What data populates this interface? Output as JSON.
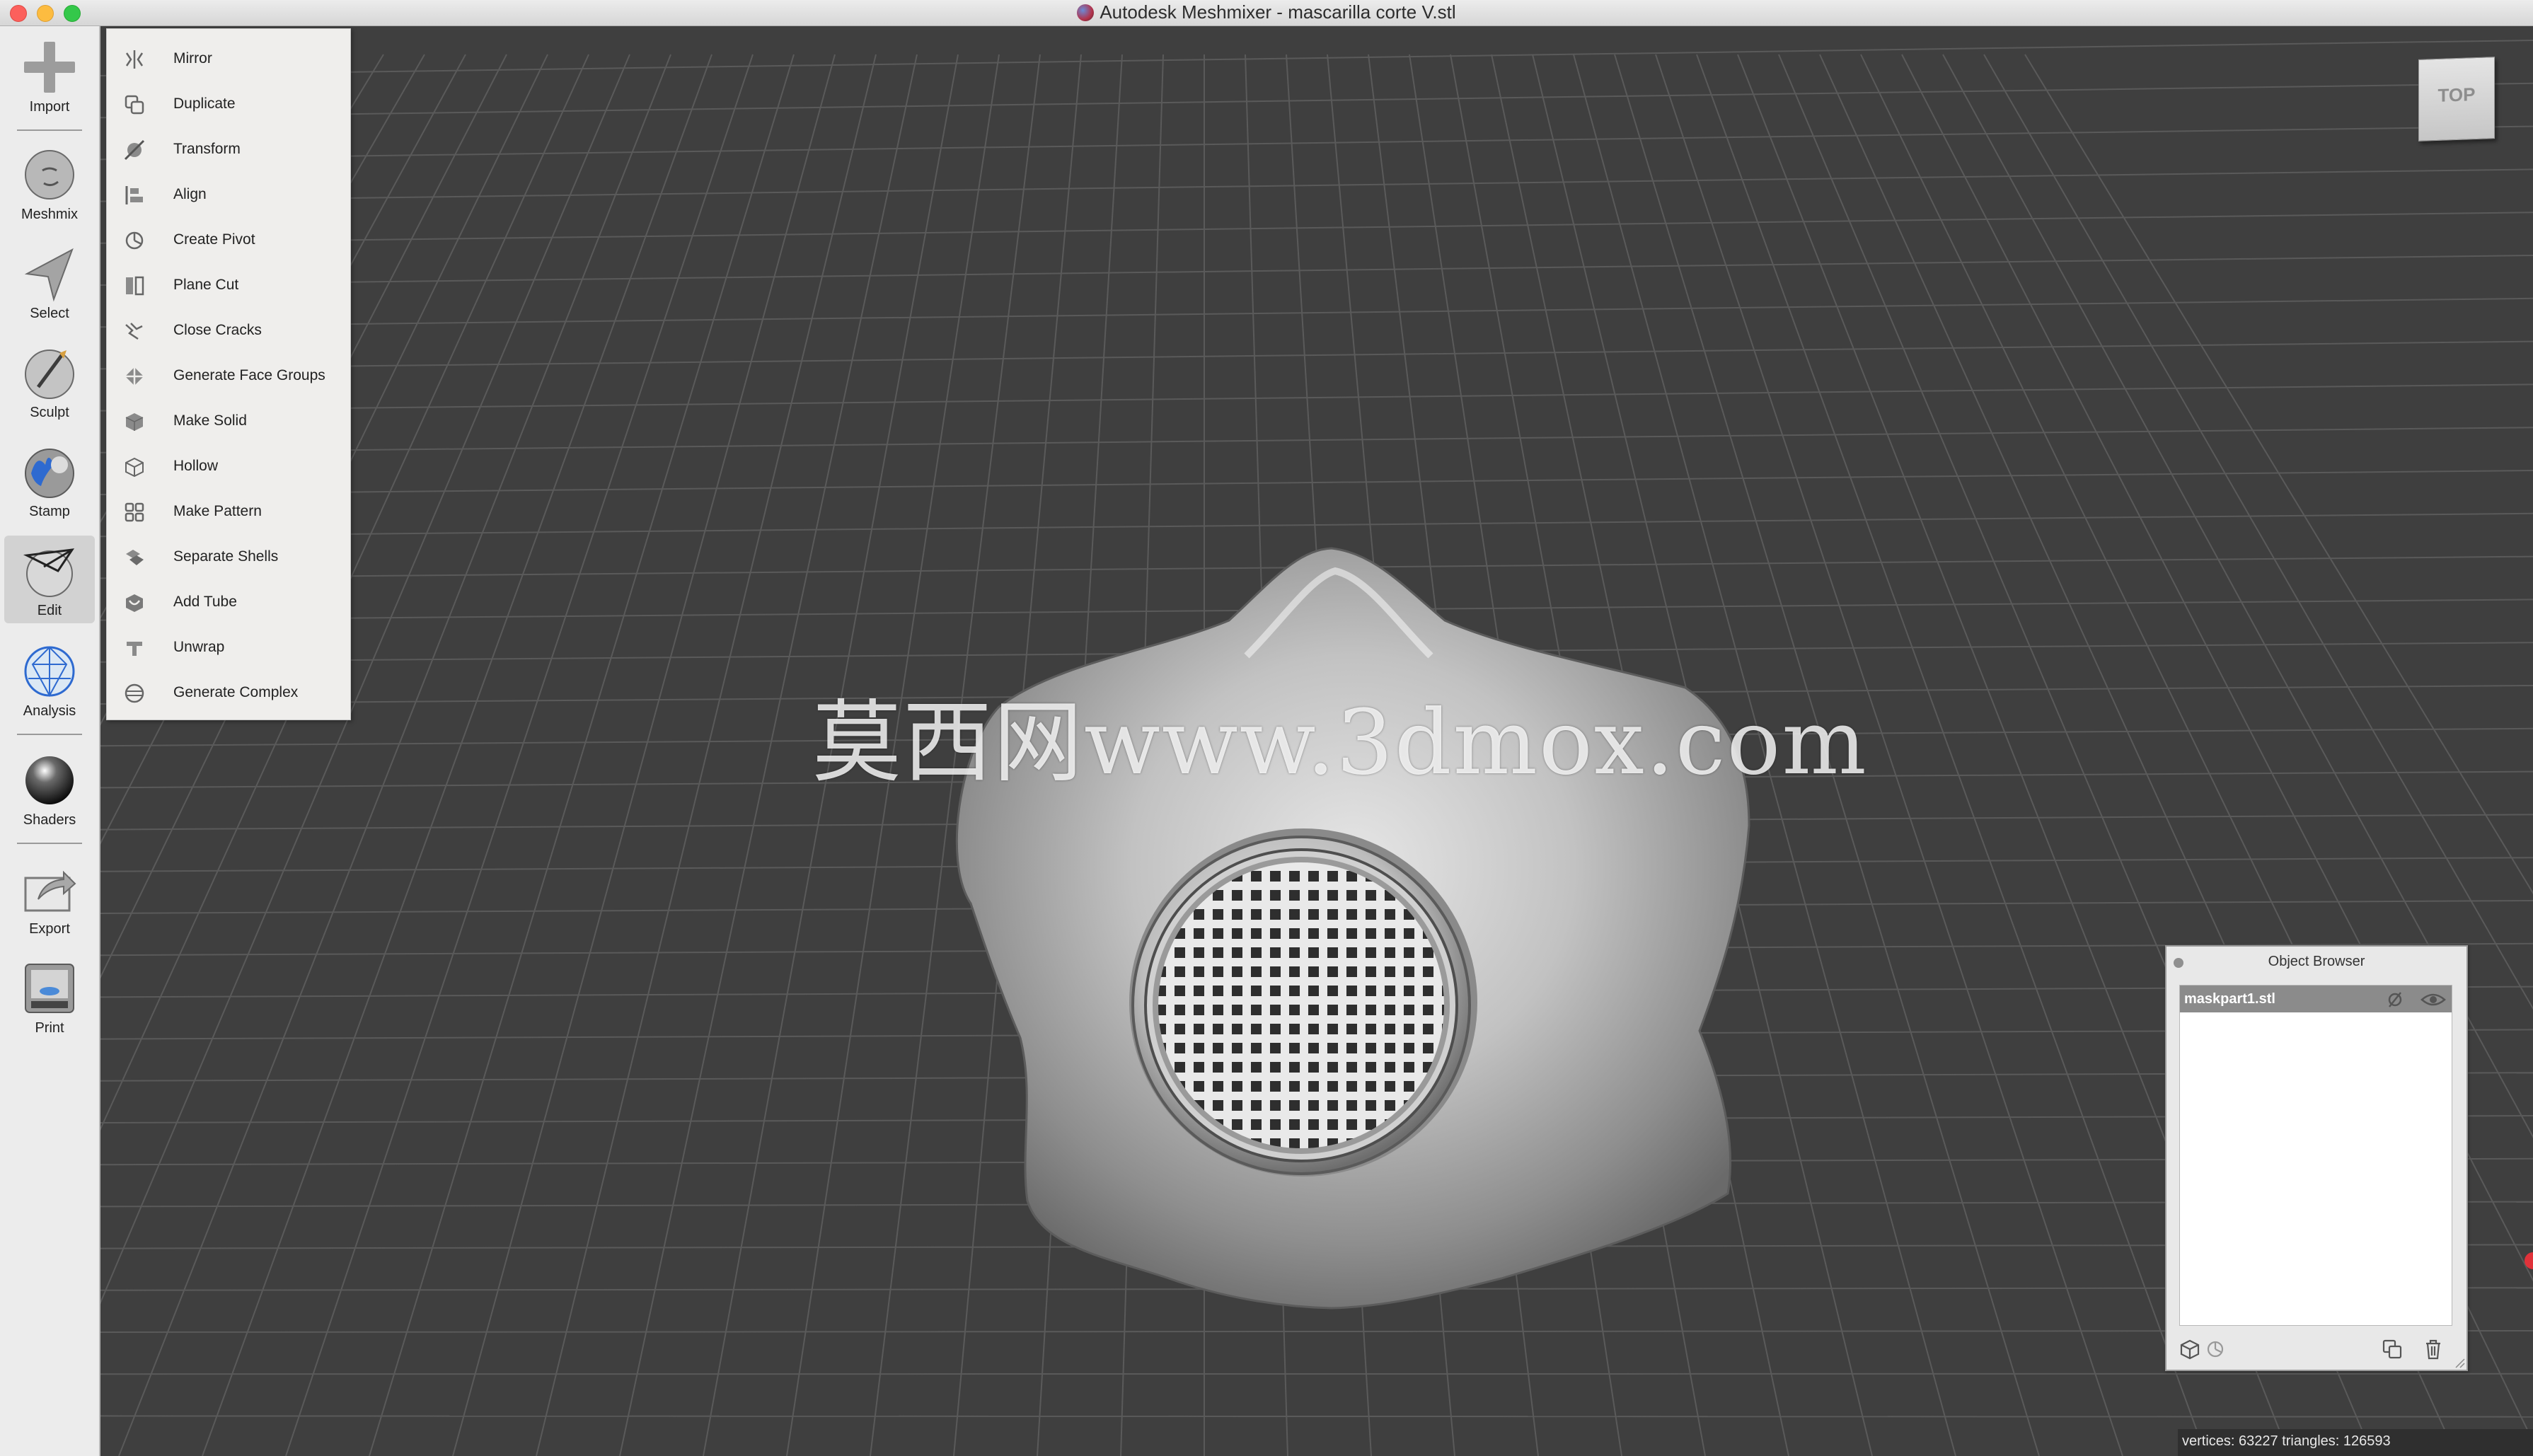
{
  "window": {
    "title": "Autodesk Meshmixer - mascarilla corte V.stl"
  },
  "toolbar": {
    "items": [
      {
        "label": "Import",
        "icon": "plus-icon"
      },
      {
        "label": "Meshmix",
        "icon": "meshmix-head-icon"
      },
      {
        "label": "Select",
        "icon": "select-arrow-icon"
      },
      {
        "label": "Sculpt",
        "icon": "sculpt-brush-icon"
      },
      {
        "label": "Stamp",
        "icon": "stamp-icon"
      },
      {
        "label": "Edit",
        "icon": "edit-sphere-icon",
        "active": true
      },
      {
        "label": "Analysis",
        "icon": "analysis-mesh-icon"
      },
      {
        "label": "Shaders",
        "icon": "shader-sphere-icon"
      },
      {
        "label": "Export",
        "icon": "export-icon"
      },
      {
        "label": "Print",
        "icon": "printer-icon"
      }
    ]
  },
  "edit_menu": {
    "items": [
      {
        "label": "Mirror",
        "icon": "mirror-icon"
      },
      {
        "label": "Duplicate",
        "icon": "duplicate-icon"
      },
      {
        "label": "Transform",
        "icon": "transform-icon"
      },
      {
        "label": "Align",
        "icon": "align-icon"
      },
      {
        "label": "Create Pivot",
        "icon": "create-pivot-icon"
      },
      {
        "label": "Plane Cut",
        "icon": "plane-cut-icon"
      },
      {
        "label": "Close Cracks",
        "icon": "close-cracks-icon"
      },
      {
        "label": "Generate Face Groups",
        "icon": "face-groups-icon"
      },
      {
        "label": "Make Solid",
        "icon": "make-solid-icon"
      },
      {
        "label": "Hollow",
        "icon": "hollow-icon"
      },
      {
        "label": "Make Pattern",
        "icon": "make-pattern-icon"
      },
      {
        "label": "Separate Shells",
        "icon": "separate-shells-icon"
      },
      {
        "label": "Add Tube",
        "icon": "add-tube-icon"
      },
      {
        "label": "Unwrap",
        "icon": "unwrap-icon"
      },
      {
        "label": "Generate Complex",
        "icon": "generate-complex-icon"
      }
    ]
  },
  "view_cube": {
    "label": "TOP"
  },
  "watermark": {
    "text": "莫西网www.3dmox.com"
  },
  "object_browser": {
    "title": "Object Browser",
    "objects": [
      {
        "name": "maskpart1.stl",
        "selected": true
      }
    ]
  },
  "status": {
    "text": "vertices: 63227 triangles: 126593"
  },
  "colors": {
    "viewport_bg": "#3f3f3f",
    "grid": "#5a5a5a",
    "toolbar_bg": "#ececec",
    "menu_bg": "#efeeec",
    "selected_row": "#8b8b8b"
  }
}
